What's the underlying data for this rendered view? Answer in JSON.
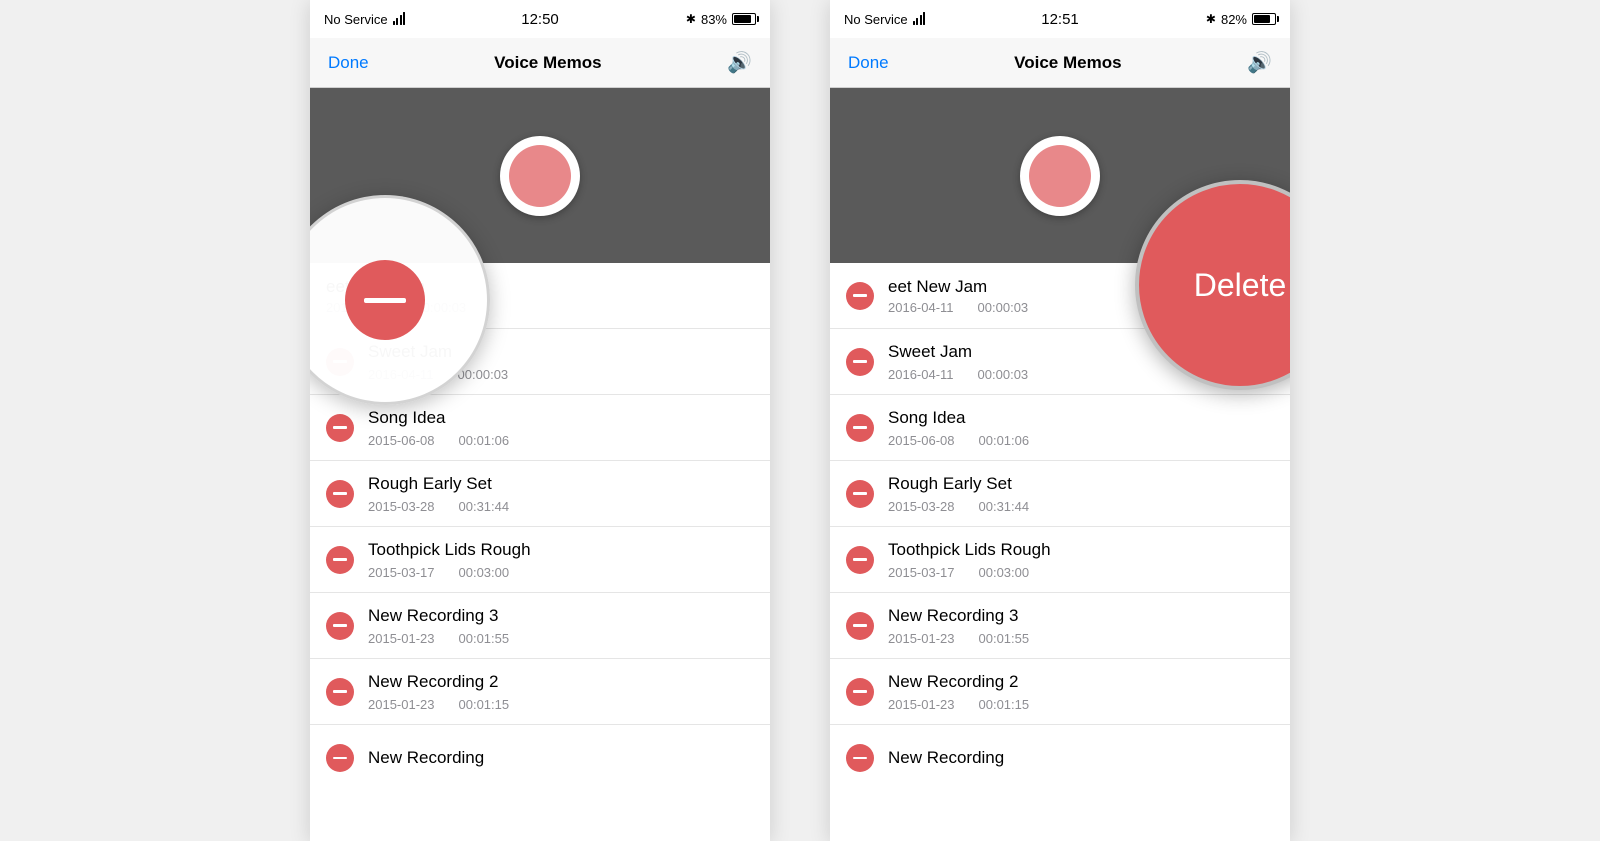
{
  "panel1": {
    "status": {
      "carrier": "No Service",
      "time": "12:50",
      "battery_pct": "83%",
      "battery_fill": "83"
    },
    "nav": {
      "done": "Done",
      "title": "Voice Memos"
    },
    "recordings": [
      {
        "name": "eet New Jam",
        "date": "2016-04-11",
        "duration": "00:00:03"
      },
      {
        "name": "Sweet Jam",
        "date": "2016-04-11",
        "duration": "00:00:03"
      },
      {
        "name": "Song Idea",
        "date": "2015-06-08",
        "duration": "00:01:06"
      },
      {
        "name": "Rough Early Set",
        "date": "2015-03-28",
        "duration": "00:31:44"
      },
      {
        "name": "Toothpick Lids Rough",
        "date": "2015-03-17",
        "duration": "00:03:00"
      },
      {
        "name": "New Recording 3",
        "date": "2015-01-23",
        "duration": "00:01:55"
      },
      {
        "name": "New Recording 2",
        "date": "2015-01-23",
        "duration": "00:01:15"
      },
      {
        "name": "New Recording",
        "date": "",
        "duration": ""
      }
    ]
  },
  "panel2": {
    "status": {
      "carrier": "No Service",
      "time": "12:51",
      "battery_pct": "82%",
      "battery_fill": "82"
    },
    "nav": {
      "done": "Done",
      "title": "Voice Memos"
    },
    "delete_label": "Delete",
    "recordings": [
      {
        "name": "eet New Jam",
        "date": "2016-04-11",
        "duration": "00:00:03"
      },
      {
        "name": "Sweet Jam",
        "date": "2016-04-11",
        "duration": "00:00:03"
      },
      {
        "name": "Song Idea",
        "date": "2015-06-08",
        "duration": "00:01:06"
      },
      {
        "name": "Rough Early Set",
        "date": "2015-03-28",
        "duration": "00:31:44"
      },
      {
        "name": "Toothpick Lids Rough",
        "date": "2015-03-17",
        "duration": "00:03:00"
      },
      {
        "name": "New Recording 3",
        "date": "2015-01-23",
        "duration": "00:01:55"
      },
      {
        "name": "New Recording 2",
        "date": "2015-01-23",
        "duration": "00:01:15"
      },
      {
        "name": "New Recording",
        "date": "",
        "duration": ""
      }
    ]
  }
}
